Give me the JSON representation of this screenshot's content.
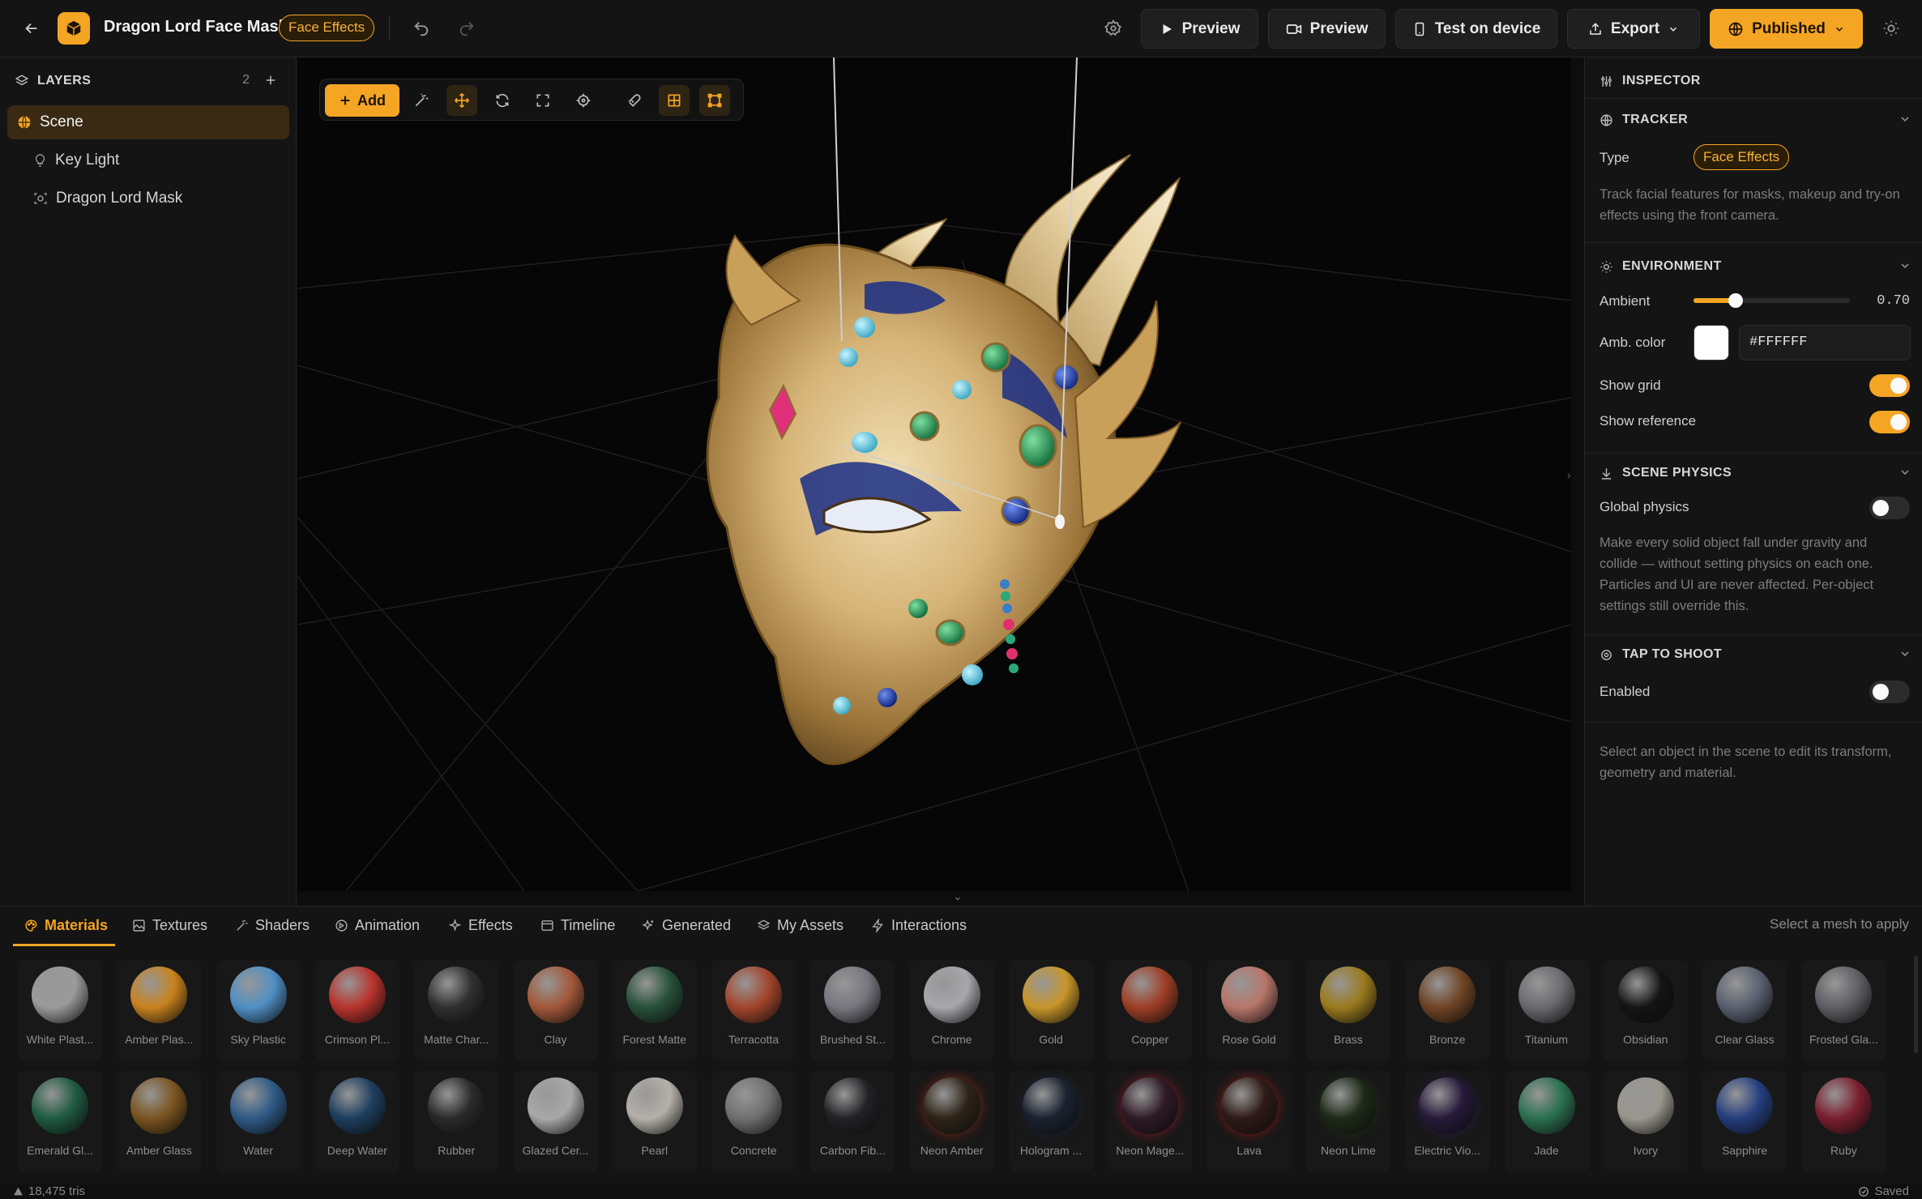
{
  "header": {
    "project_title": "Dragon Lord Face Mask",
    "effect_tag": "Face Effects",
    "buttons": {
      "preview_play": "Preview",
      "preview_camera": "Preview",
      "test_device": "Test on device",
      "export": "Export",
      "published": "Published"
    }
  },
  "layers": {
    "title": "LAYERS",
    "count": "2",
    "items": [
      {
        "label": "Scene",
        "icon": "globe-icon"
      },
      {
        "label": "Key Light",
        "icon": "lightbulb-icon"
      },
      {
        "label": "Dragon Lord Mask",
        "icon": "face-scan-icon"
      }
    ]
  },
  "toolbar": {
    "add_label": "Add"
  },
  "inspector": {
    "title": "INSPECTOR",
    "tracker": {
      "title": "TRACKER",
      "type_label": "Type",
      "type_value": "Face Effects",
      "help": "Track facial features for masks, makeup and try-on effects using the front camera."
    },
    "environment": {
      "title": "ENVIRONMENT",
      "ambient_label": "Ambient",
      "ambient_value": "0.70",
      "ambient_fraction": 0.27,
      "amb_color_label": "Amb. color",
      "amb_color_value": "#FFFFFF",
      "show_grid_label": "Show grid",
      "show_grid": true,
      "show_reference_label": "Show reference",
      "show_reference": true
    },
    "physics": {
      "title": "SCENE PHYSICS",
      "global_label": "Global physics",
      "global_enabled": false,
      "help": "Make every solid object fall under gravity and collide — without setting physics on each one. Particles and UI are never affected. Per-object settings still override this."
    },
    "tap_to_shoot": {
      "title": "TAP TO SHOOT",
      "enabled_label": "Enabled",
      "enabled": false
    },
    "empty_hint": "Select an object in the scene to edit its transform, geometry and material."
  },
  "bottom": {
    "tabs": [
      "Materials",
      "Textures",
      "Shaders",
      "Animation",
      "Effects",
      "Timeline",
      "Generated",
      "My Assets",
      "Interactions"
    ],
    "apply_hint": "Select a mesh to apply",
    "materials_row1": [
      {
        "name": "White Plast...",
        "color": "#9a9a9a"
      },
      {
        "name": "Amber Plas...",
        "color": "#c8821e"
      },
      {
        "name": "Sky Plastic",
        "color": "#4f8fc4"
      },
      {
        "name": "Crimson Pl...",
        "color": "#b8332c"
      },
      {
        "name": "Matte Char...",
        "color": "#2f2f2f"
      },
      {
        "name": "Clay",
        "color": "#a2583a"
      },
      {
        "name": "Forest Matte",
        "color": "#27503a"
      },
      {
        "name": "Terracotta",
        "color": "#a2452c"
      },
      {
        "name": "Brushed St...",
        "color": "#77777f"
      },
      {
        "name": "Chrome",
        "color": "#a6a6ac"
      },
      {
        "name": "Gold",
        "color": "#c8962a"
      },
      {
        "name": "Copper",
        "color": "#9e3e26"
      },
      {
        "name": "Rose Gold",
        "color": "#b8766a"
      },
      {
        "name": "Brass",
        "color": "#9a7a1e"
      },
      {
        "name": "Bronze",
        "color": "#6e4424"
      },
      {
        "name": "Titanium",
        "color": "#6a6a70"
      },
      {
        "name": "Obsidian",
        "color": "#141414"
      },
      {
        "name": "Clear Glass",
        "color": "#5a6070"
      },
      {
        "name": "Frosted Gla...",
        "color": "#5e5e64"
      }
    ],
    "materials_row2": [
      {
        "name": "Emerald Gl...",
        "color": "#1e5a40"
      },
      {
        "name": "Amber Glass",
        "color": "#7a5420"
      },
      {
        "name": "Water",
        "color": "#2e5a86"
      },
      {
        "name": "Deep Water",
        "color": "#1e3e5e"
      },
      {
        "name": "Rubber",
        "color": "#2a2a2a"
      },
      {
        "name": "Glazed Cer...",
        "color": "#a8a8a8"
      },
      {
        "name": "Pearl",
        "color": "#b4b0a8"
      },
      {
        "name": "Concrete",
        "color": "#707070"
      },
      {
        "name": "Carbon Fib...",
        "color": "#222226"
      },
      {
        "name": "Neon Amber",
        "color": "#2e2418"
      },
      {
        "name": "Hologram ...",
        "color": "#1a2230"
      },
      {
        "name": "Neon Mage...",
        "color": "#2e1a26"
      },
      {
        "name": "Lava",
        "color": "#2e1a16"
      },
      {
        "name": "Neon Lime",
        "color": "#1e2a18"
      },
      {
        "name": "Electric Vio...",
        "color": "#261a3a"
      },
      {
        "name": "Jade",
        "color": "#2a7050"
      },
      {
        "name": "Ivory",
        "color": "#9a968e"
      },
      {
        "name": "Sapphire",
        "color": "#243e7e"
      },
      {
        "name": "Ruby",
        "color": "#7a1e2e"
      }
    ]
  },
  "status": {
    "tris": "18,475 tris",
    "saved": "Saved"
  },
  "colors": {
    "accent": "#f5a524",
    "panel": "#141414",
    "viewport": "#060606"
  }
}
